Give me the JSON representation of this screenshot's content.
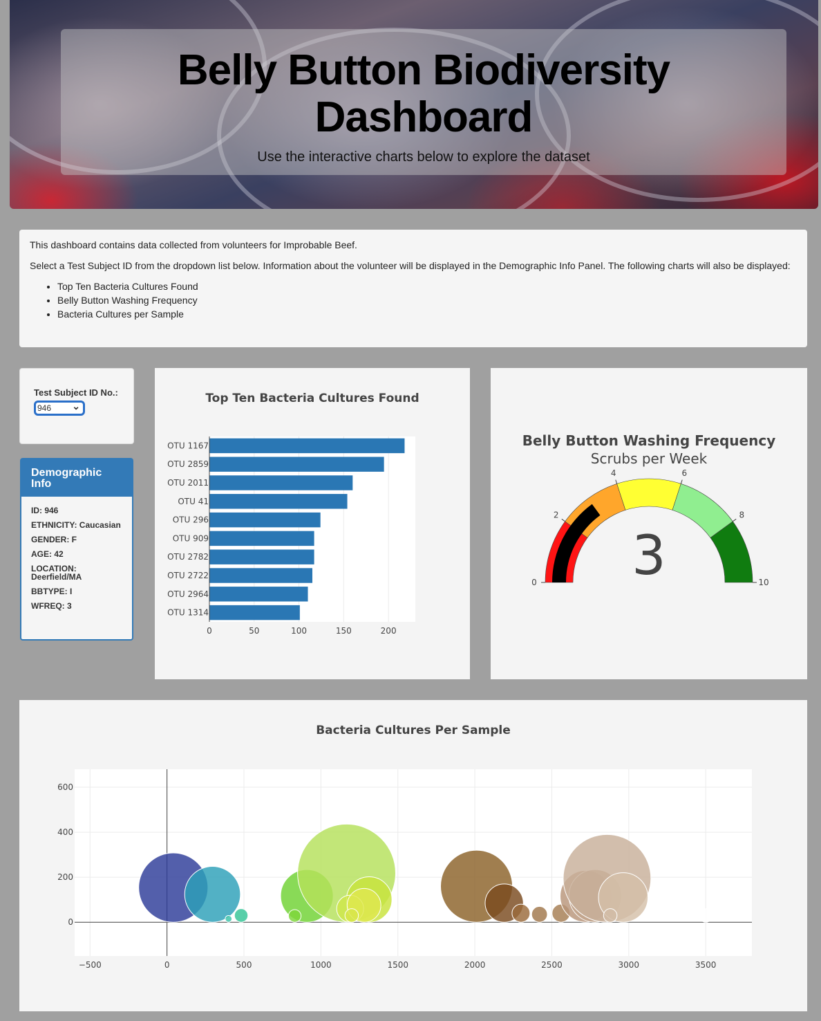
{
  "header": {
    "title": "Belly Button Biodiversity Dashboard",
    "subtitle": "Use the interactive charts below to explore the dataset"
  },
  "intro": {
    "line1": "This dashboard contains data collected from volunteers for Improbable Beef.",
    "line2": "Select a Test Subject ID from the dropdown list below. Information about the volunteer will be displayed in the Demographic Info Panel. The following charts will also be displayed:",
    "items": [
      "Top Ten Bacteria Cultures Found",
      "Belly Button Washing Frequency",
      "Bacteria Cultures per Sample"
    ]
  },
  "selector": {
    "label": "Test Subject ID No.:",
    "value": "946"
  },
  "demographic": {
    "title": "Demographic Info",
    "rows": [
      "ID: 946",
      "ETHNICITY: Caucasian",
      "GENDER: F",
      "AGE: 42",
      "LOCATION: Deerfield/MA",
      "BBTYPE: I",
      "WFREQ: 3"
    ]
  },
  "chart_data": [
    {
      "type": "bar",
      "orientation": "horizontal",
      "title": "Top Ten Bacteria Cultures Found",
      "categories": [
        "OTU 1167",
        "OTU 2859",
        "OTU 2011",
        "OTU 41",
        "OTU 296",
        "OTU 909",
        "OTU 2782",
        "OTU 2722",
        "OTU 2964",
        "OTU 1314"
      ],
      "values": [
        218,
        195,
        160,
        154,
        124,
        117,
        117,
        115,
        110,
        101
      ],
      "xlim": [
        0,
        230
      ],
      "xticks": [
        0,
        50,
        100,
        150,
        200
      ],
      "color": "#2a77b4"
    },
    {
      "type": "gauge",
      "title": "Belly Button Washing Frequency",
      "subtitle": "Scrubs per Week",
      "value": 3,
      "range": [
        0,
        10
      ],
      "ticks": [
        0,
        2,
        4,
        6,
        8,
        10
      ],
      "steps": [
        {
          "range": [
            0,
            2
          ],
          "color": "#ff1414"
        },
        {
          "range": [
            2,
            4
          ],
          "color": "#ffa62b"
        },
        {
          "range": [
            4,
            6
          ],
          "color": "#ffff33"
        },
        {
          "range": [
            6,
            8
          ],
          "color": "#90ee90"
        },
        {
          "range": [
            8,
            10
          ],
          "color": "#107c10"
        }
      ],
      "bar_color": "#000000"
    },
    {
      "type": "scatter",
      "title": "Bacteria Cultures Per Sample",
      "xlim": [
        -600,
        3800
      ],
      "ylim": [
        -150,
        680
      ],
      "xticks": [
        -500,
        0,
        500,
        1000,
        1500,
        2000,
        2500,
        3000,
        3500
      ],
      "yticks": [
        0,
        200,
        400,
        600
      ],
      "points": [
        {
          "x": 41,
          "y": 154,
          "r": 154,
          "color": "#2d3c99"
        },
        {
          "x": 296,
          "y": 124,
          "r": 124,
          "color": "#2ca0b8"
        },
        {
          "x": 400,
          "y": 15,
          "r": 15,
          "color": "#3cc3a8"
        },
        {
          "x": 482,
          "y": 30,
          "r": 30,
          "color": "#33c496"
        },
        {
          "x": 909,
          "y": 117,
          "r": 117,
          "color": "#6fd232"
        },
        {
          "x": 830,
          "y": 28,
          "r": 28,
          "color": "#7ed63b"
        },
        {
          "x": 1167,
          "y": 218,
          "r": 218,
          "color": "#b4e05a"
        },
        {
          "x": 1314,
          "y": 101,
          "r": 101,
          "color": "#c8e33c"
        },
        {
          "x": 1190,
          "y": 60,
          "r": 60,
          "color": "#d0e64a"
        },
        {
          "x": 1280,
          "y": 75,
          "r": 75,
          "color": "#dfe84f"
        },
        {
          "x": 1200,
          "y": 30,
          "r": 30,
          "color": "#d8e54a"
        },
        {
          "x": 2011,
          "y": 160,
          "r": 160,
          "color": "#8b6228"
        },
        {
          "x": 2191,
          "y": 85,
          "r": 85,
          "color": "#7a4a1e"
        },
        {
          "x": 2300,
          "y": 40,
          "r": 40,
          "color": "#9a6a3a"
        },
        {
          "x": 2420,
          "y": 35,
          "r": 35,
          "color": "#a0764a"
        },
        {
          "x": 2560,
          "y": 40,
          "r": 40,
          "color": "#a57c52"
        },
        {
          "x": 2722,
          "y": 115,
          "r": 115,
          "color": "#b8957a"
        },
        {
          "x": 2782,
          "y": 117,
          "r": 117,
          "color": "#c2a68d"
        },
        {
          "x": 2859,
          "y": 195,
          "r": 195,
          "color": "#c8b09a"
        },
        {
          "x": 2964,
          "y": 110,
          "r": 110,
          "color": "#d4bfa8"
        },
        {
          "x": 2880,
          "y": 30,
          "r": 30,
          "color": "#d2bca6"
        },
        {
          "x": 3500,
          "y": 30,
          "r": 30,
          "color": "#ffffff"
        }
      ]
    }
  ]
}
